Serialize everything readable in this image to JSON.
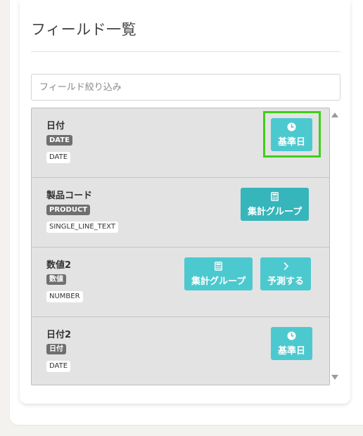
{
  "page": {
    "title": "フィールド一覧",
    "filter_placeholder": "フィールド絞り込み"
  },
  "fields": [
    {
      "name": "日付",
      "badge": "DATE",
      "type": "DATE",
      "actions": [
        "基準日"
      ]
    },
    {
      "name": "製品コード",
      "badge": "PRODUCT",
      "type": "SINGLE_LINE_TEXT",
      "actions": [
        "集計グループ"
      ]
    },
    {
      "name": "数値2",
      "badge": "数値",
      "type": "NUMBER",
      "actions": [
        "集計グループ",
        "予測する"
      ]
    },
    {
      "name": "日付2",
      "badge": "日付",
      "type": "DATE",
      "actions": [
        "基準日"
      ]
    }
  ],
  "icons": {
    "base_date": "clock-icon",
    "aggregate_group": "calculator-icon",
    "predict": "chevron-right-icon"
  },
  "colors": {
    "button": "#4cc9cf",
    "button_active": "#36b5bb",
    "highlight": "#3fd017",
    "badge": "#6f6f6f"
  }
}
